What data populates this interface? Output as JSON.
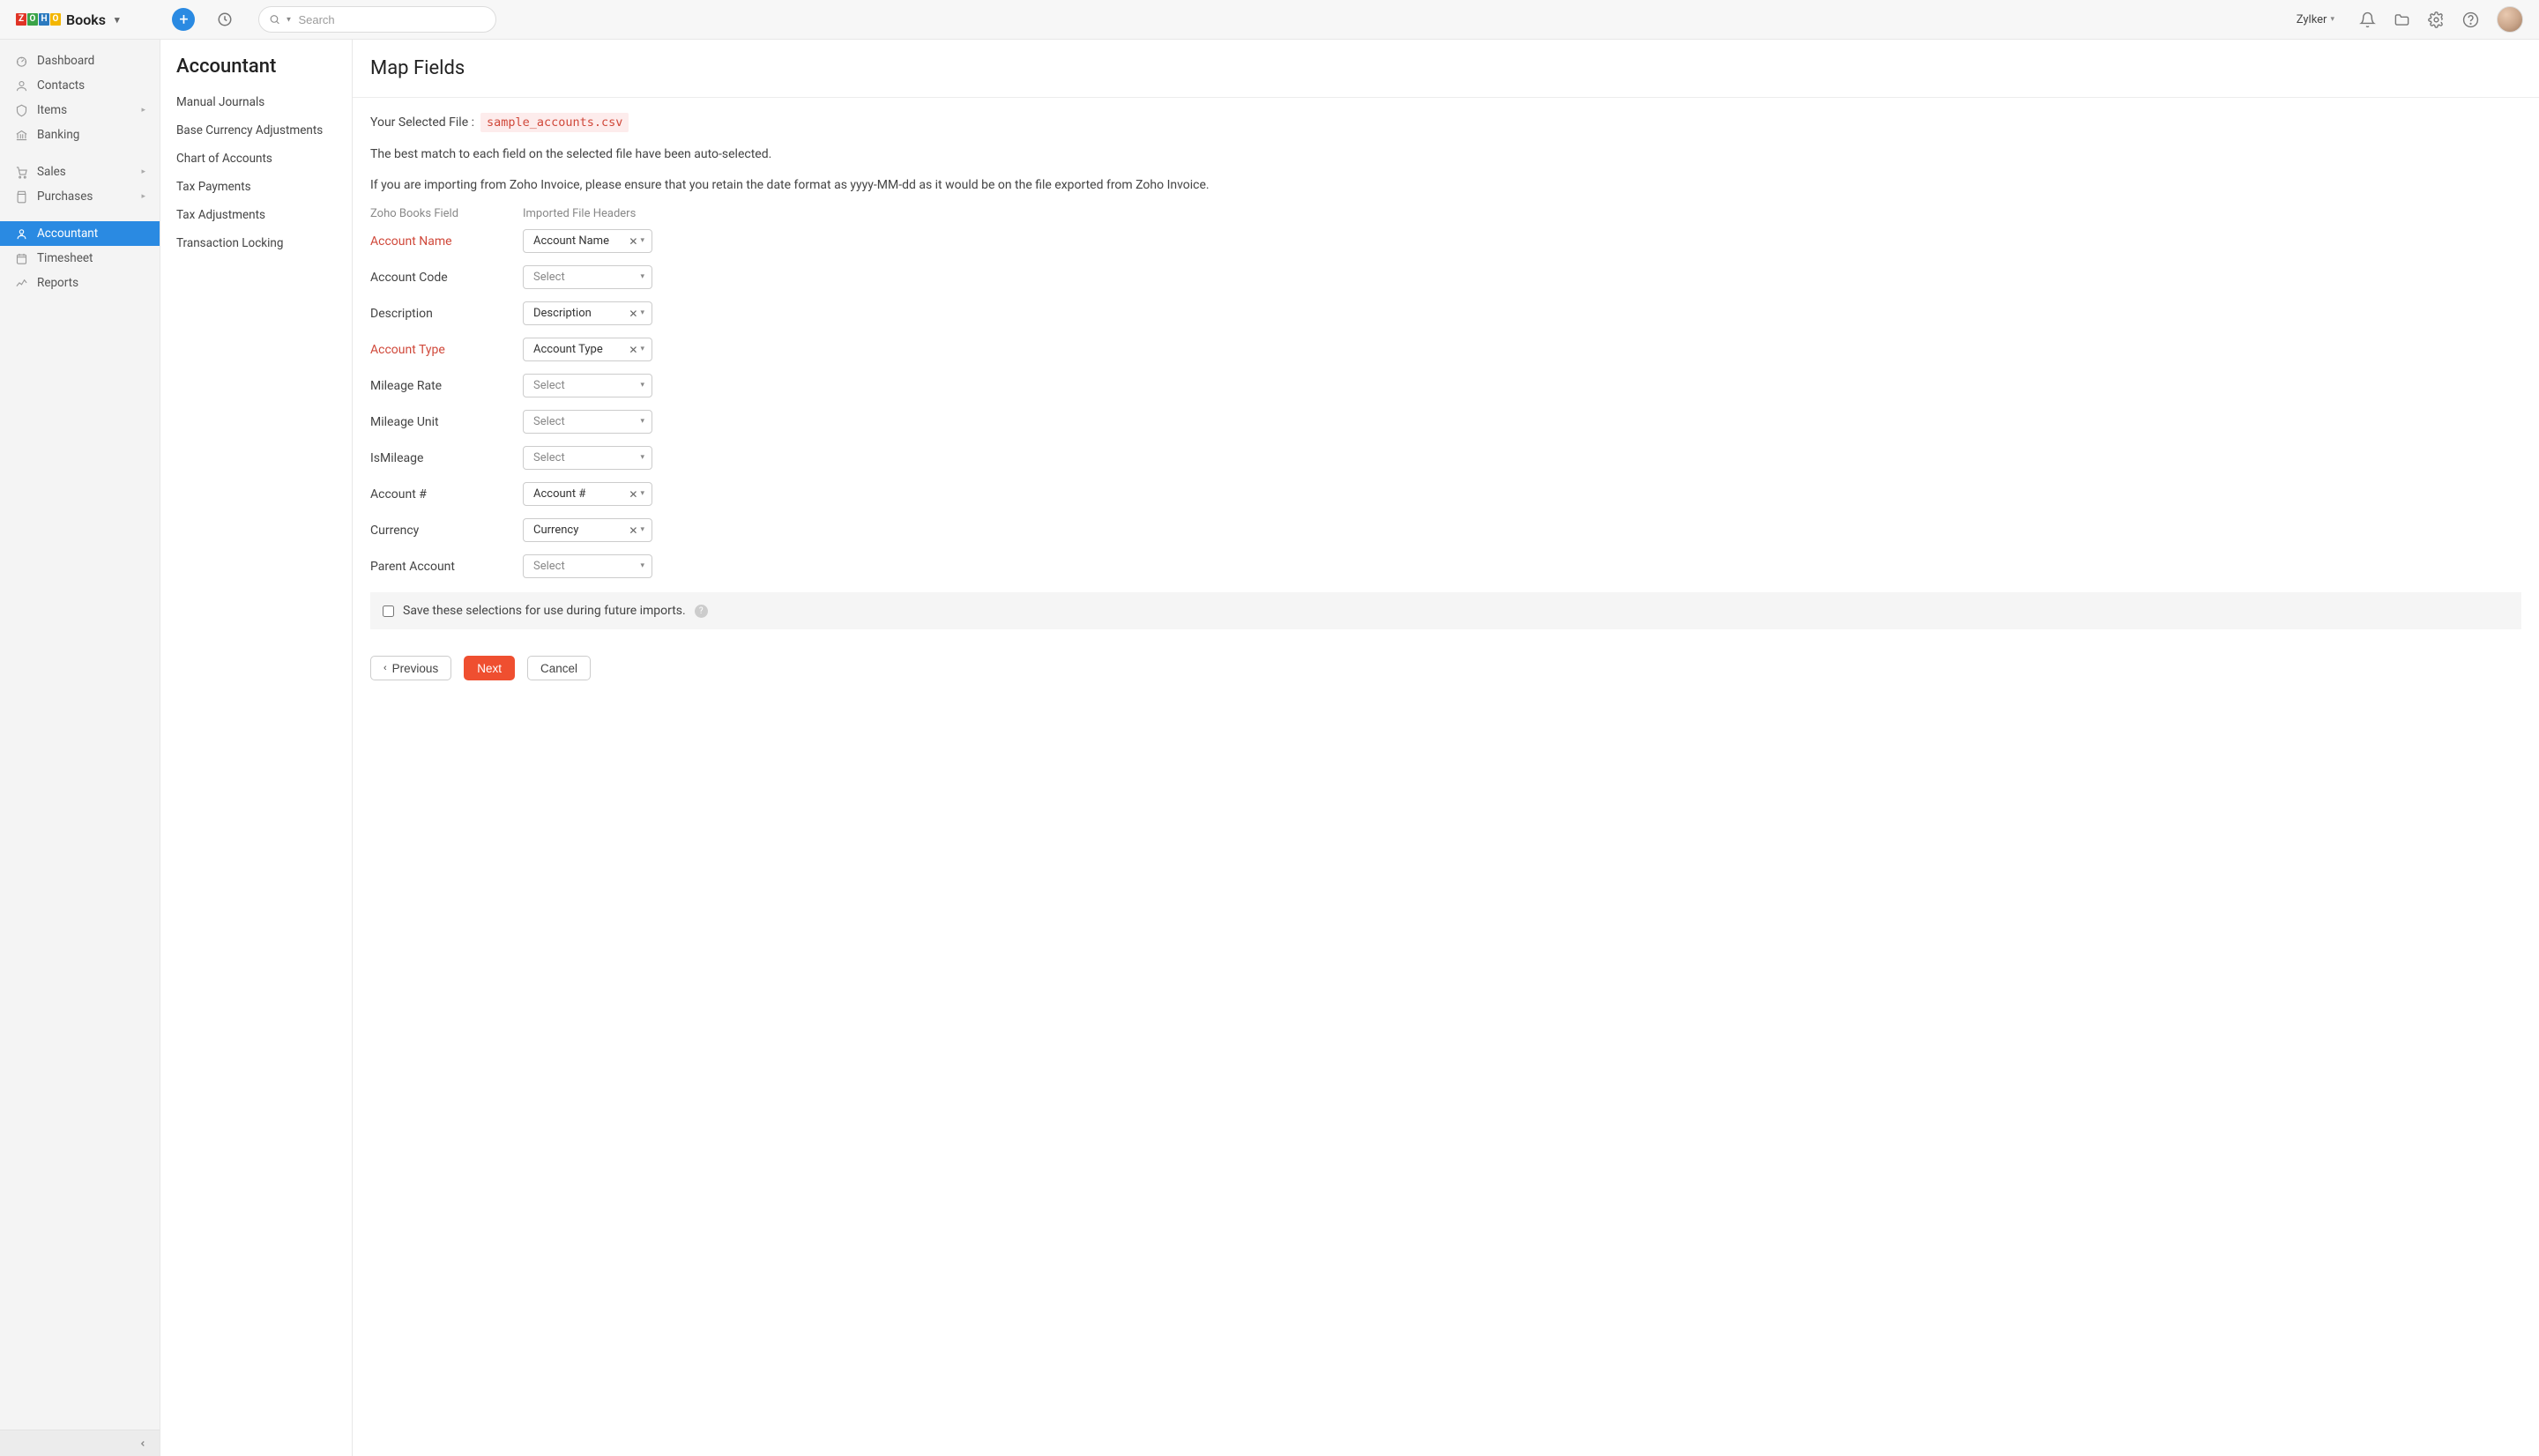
{
  "header": {
    "app_name": "Books",
    "logo_letters": [
      "Z",
      "O",
      "H",
      "O"
    ],
    "search_placeholder": "Search",
    "org_name": "Zylker"
  },
  "leftnav": {
    "items": [
      {
        "label": "Dashboard",
        "icon": "dashboard"
      },
      {
        "label": "Contacts",
        "icon": "contacts"
      },
      {
        "label": "Items",
        "icon": "items",
        "caret": true
      },
      {
        "label": "Banking",
        "icon": "banking"
      }
    ],
    "items2": [
      {
        "label": "Sales",
        "icon": "sales",
        "caret": true
      },
      {
        "label": "Purchases",
        "icon": "purchases",
        "caret": true
      }
    ],
    "items3": [
      {
        "label": "Accountant",
        "icon": "accountant",
        "active": true
      },
      {
        "label": "Timesheet",
        "icon": "timesheet"
      },
      {
        "label": "Reports",
        "icon": "reports"
      }
    ]
  },
  "subnav": {
    "title": "Accountant",
    "items": [
      "Manual Journals",
      "Base Currency Adjustments",
      "Chart of Accounts",
      "Tax Payments",
      "Tax Adjustments",
      "Transaction Locking"
    ]
  },
  "main": {
    "title": "Map Fields",
    "selected_file_label": "Your Selected File :",
    "selected_file": "sample_accounts.csv",
    "info1": "The best match to each field on the selected file have been auto-selected.",
    "info2": "If you are importing from Zoho Invoice, please ensure that you retain the date format as yyyy-MM-dd as it would be on the file exported from Zoho Invoice.",
    "col1": "Zoho Books Field",
    "col2": "Imported File Headers",
    "select_placeholder": "Select",
    "fields": [
      {
        "label": "Account Name",
        "required": true,
        "value": "Account Name"
      },
      {
        "label": "Account Code",
        "required": false,
        "value": ""
      },
      {
        "label": "Description",
        "required": false,
        "value": "Description"
      },
      {
        "label": "Account Type",
        "required": true,
        "value": "Account Type"
      },
      {
        "label": "Mileage Rate",
        "required": false,
        "value": ""
      },
      {
        "label": "Mileage Unit",
        "required": false,
        "value": ""
      },
      {
        "label": "IsMileage",
        "required": false,
        "value": ""
      },
      {
        "label": "Account #",
        "required": false,
        "value": "Account #"
      },
      {
        "label": "Currency",
        "required": false,
        "value": "Currency"
      },
      {
        "label": "Parent Account",
        "required": false,
        "value": ""
      }
    ],
    "save_label": "Save these selections for use during future imports.",
    "btn_prev": "Previous",
    "btn_next": "Next",
    "btn_cancel": "Cancel"
  }
}
